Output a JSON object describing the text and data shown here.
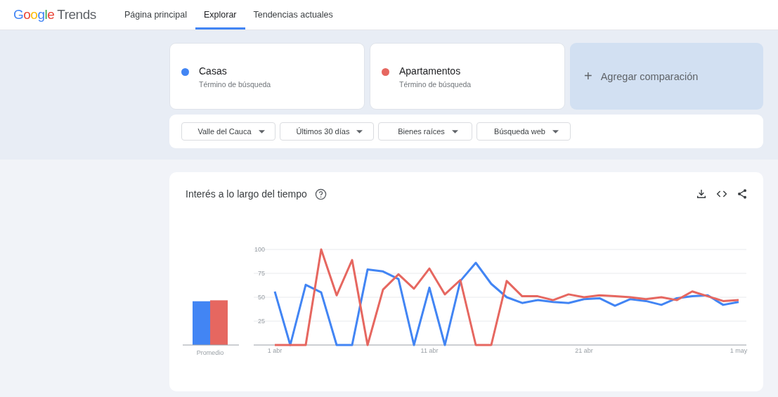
{
  "header": {
    "logo": {
      "brand": "Google",
      "product": "Trends"
    },
    "nav": [
      {
        "label": "Página principal",
        "selected": false
      },
      {
        "label": "Explorar",
        "selected": true
      },
      {
        "label": "Tendencias actuales",
        "selected": false
      }
    ]
  },
  "terms": [
    {
      "name": "Casas",
      "subtitle": "Término de búsqueda",
      "color": "#4285f4"
    },
    {
      "name": "Apartamentos",
      "subtitle": "Término de búsqueda",
      "color": "#e66760"
    }
  ],
  "add_comparison": {
    "icon": "+",
    "label": "Agregar comparación"
  },
  "filters": [
    "Valle del Cauca",
    "Últimos 30 días",
    "Bienes raíces",
    "Búsqueda web"
  ],
  "interest_card": {
    "title": "Interés a lo largo del tiempo",
    "average_label": "Promedio",
    "chart_data": {
      "type": "line",
      "categories": [
        "1 abr",
        null,
        null,
        null,
        null,
        null,
        null,
        null,
        null,
        null,
        "11 abr",
        null,
        null,
        null,
        null,
        null,
        null,
        null,
        null,
        null,
        "21 abr",
        null,
        null,
        null,
        null,
        null,
        null,
        null,
        null,
        null,
        "1 may"
      ],
      "yticks": [
        25,
        50,
        75,
        100
      ],
      "ylim": [
        0,
        100
      ],
      "grid": true,
      "series": [
        {
          "color": "#4285f4",
          "values": [
            56,
            0,
            63,
            55,
            0,
            0,
            79,
            77,
            69,
            0,
            60,
            0,
            67,
            86,
            64,
            50,
            44,
            47,
            45,
            44,
            48,
            49,
            41,
            48,
            46,
            42,
            49,
            51,
            52,
            42,
            45
          ]
        },
        {
          "color": "#e66760",
          "values": [
            0,
            0,
            0,
            100,
            52,
            89,
            0,
            58,
            74,
            59,
            80,
            53,
            68,
            0,
            0,
            67,
            51,
            51,
            47,
            53,
            50,
            52,
            51,
            50,
            48,
            50,
            47,
            56,
            51,
            46,
            47
          ]
        }
      ]
    }
  }
}
